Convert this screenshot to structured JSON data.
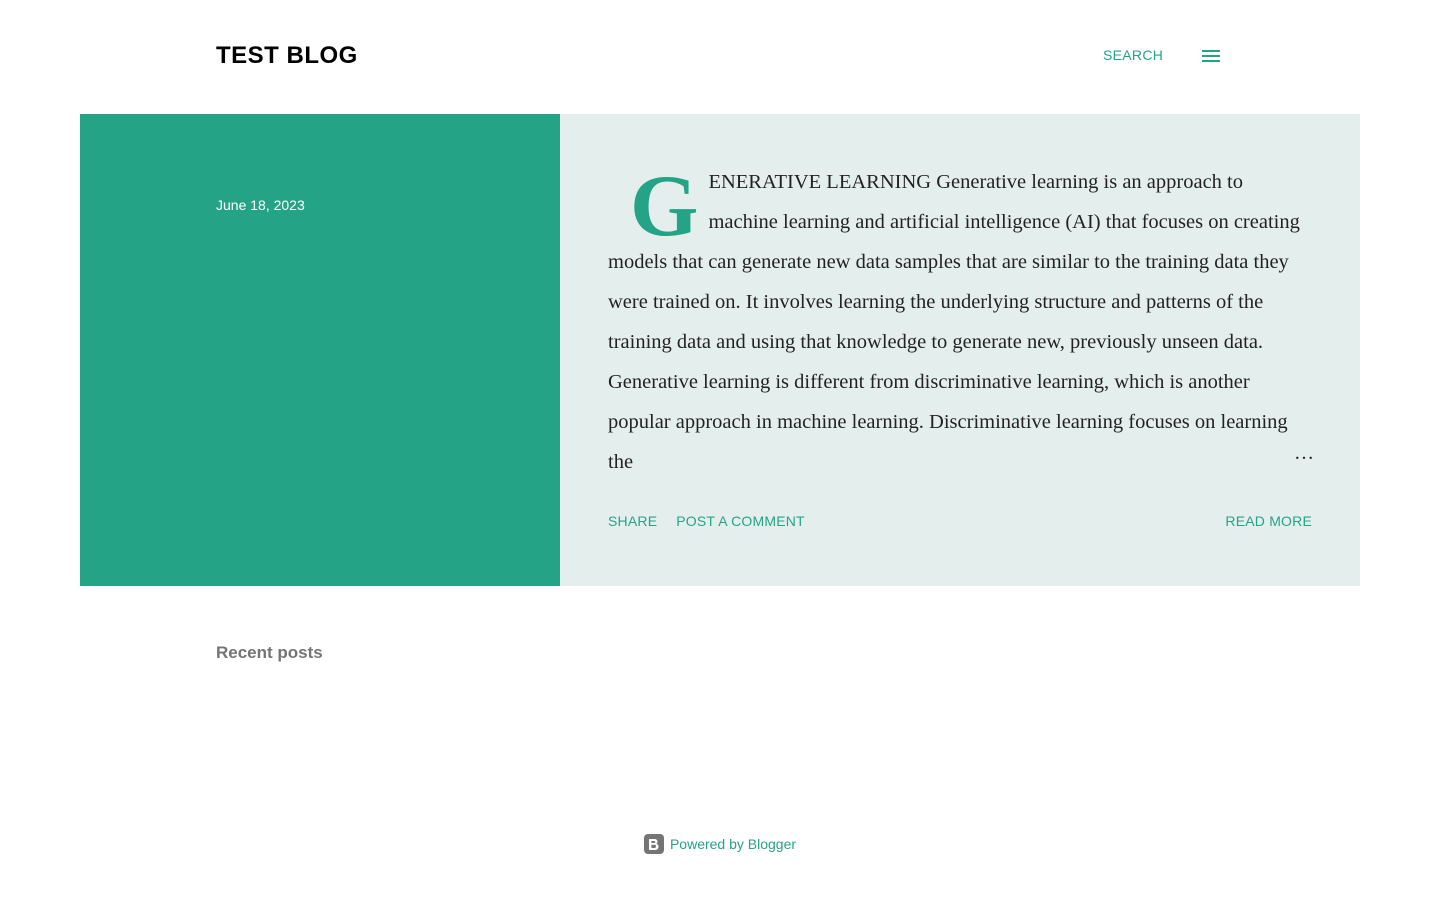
{
  "header": {
    "blog_title": "TEST BLOG",
    "search_label": "SEARCH",
    "menu_icon": "menu-icon"
  },
  "post": {
    "date": "June 18, 2023",
    "drop_cap": "G",
    "lead": "enerative  Learning",
    "snippet": "Generative learning is an approach to machine learning and artificial intelligence (AI) that focuses on creating models that can generate new data samples that are similar to the training data they were trained on. It involves learning the underlying structure and patterns of the training data and using that knowledge to generate new, previously unseen data. Generative learning is different from discriminative learning, which is another popular approach in machine learning. Discriminative learning focuses on learning the",
    "ellipsis": "…",
    "share_label": "Share",
    "comment_label": "Post a Comment",
    "read_more_label": "Read more"
  },
  "recent": {
    "label": "Recent posts"
  },
  "footer": {
    "powered_label": "Powered by Blogger",
    "icon": "blogger-icon"
  },
  "colors": {
    "accent": "#24a387",
    "card_bg": "#e4efed",
    "muted": "#757575"
  }
}
